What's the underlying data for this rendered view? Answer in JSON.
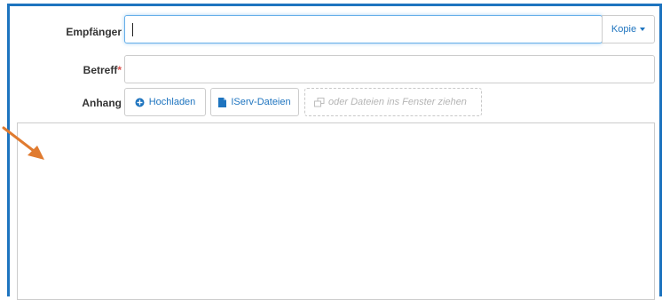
{
  "form": {
    "recipient_label": "Empfänger",
    "recipient_value": "",
    "copy_button": "Kopie",
    "subject_label": "Betreff",
    "subject_required_mark": "*",
    "subject_value": "",
    "attachment_label": "Anhang",
    "upload_button": "Hochladen",
    "iserv_files_button": "IServ-Dateien",
    "dropzone_text": "oder Dateien ins Fenster ziehen"
  },
  "colors": {
    "frame_border": "#1e74bf",
    "link_blue": "#1e74bf",
    "annotation_arrow": "#e07b30",
    "required_red": "#d9534f"
  },
  "icons": {
    "upload": "circle-plus-icon",
    "iserv_files": "file-icon",
    "dropzone": "copy-windows-icon",
    "copy_dropdown": "caret-down-icon",
    "annotation": "arrow-annotation-icon"
  }
}
